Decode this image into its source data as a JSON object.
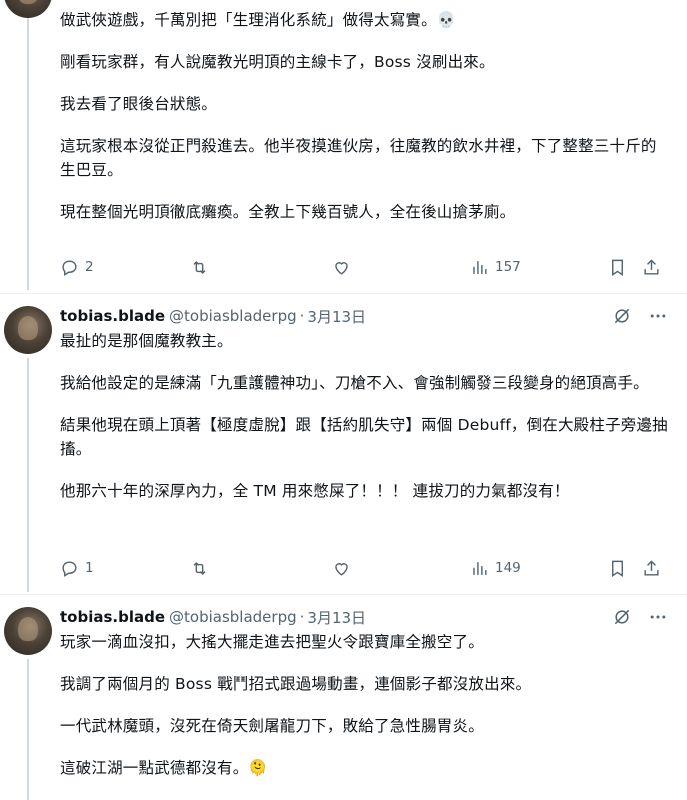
{
  "tweets": [
    {
      "paragraphs": [
        "做武俠遊戲，千萬別把「生理消化系統」做得太寫實。💀",
        "剛看玩家群，有人說魔教光明頂的主線卡了，Boss 沒刷出來。",
        "我去看了眼後台狀態。",
        "這玩家根本沒從正門殺進去。他半夜摸進伙房，往魔教的飲水井裡，下了整整三十斤的生巴豆。",
        "現在整個光明頂徹底癱瘓。全教上下幾百號人，全在後山搶茅廁。"
      ],
      "replies": "2",
      "views": "157"
    },
    {
      "name": "tobias.blade",
      "handle": "@tobiasbladerpg",
      "date": "3月13日",
      "paragraphs": [
        "最扯的是那個魔教教主。",
        "我給他設定的是練滿「九重護體神功」、刀槍不入、會強制觸發三段變身的絕頂高手。",
        "結果他現在頭上頂著【極度虛脫】跟【括約肌失守】兩個 Debuff，倒在大殿柱子旁邊抽搐。",
        "他那六十年的深厚內力，全 TM 用來憋屎了！！！ 連拔刀的力氣都沒有！"
      ],
      "replies": "1",
      "views": "149"
    },
    {
      "name": "tobias.blade",
      "handle": "@tobiasbladerpg",
      "date": "3月13日",
      "paragraphs": [
        "玩家一滴血沒扣，大搖大擺走進去把聖火令跟寶庫全搬空了。",
        "我調了兩個月的 Boss 戰鬥招式跟過場動畫，連個影子都沒放出來。",
        "一代武林魔頭，沒死在倚天劍屠龍刀下，敗給了急性腸胃炎。",
        "這破江湖一點武德都沒有。🫠"
      ]
    }
  ],
  "icons": {
    "reply": "reply-icon",
    "repost": "repost-icon",
    "like": "heart-icon",
    "views": "views-icon",
    "bookmark": "bookmark-icon",
    "share": "share-icon",
    "grok": "grok-icon",
    "more": "more-icon"
  },
  "colors": {
    "text": "#0f1419",
    "secondary": "#536471",
    "thread_line": "#cfd9de",
    "divider": "#eff3f4"
  }
}
